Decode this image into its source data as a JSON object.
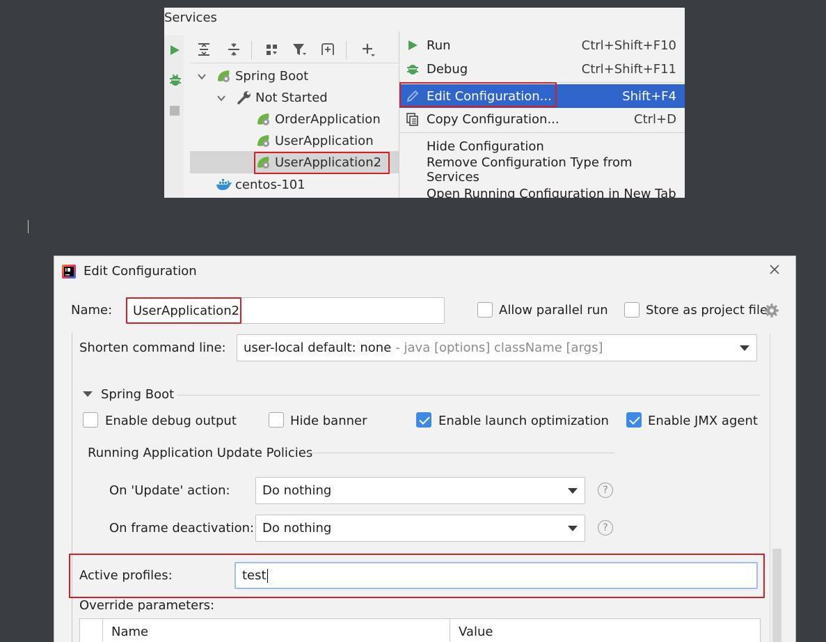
{
  "services": {
    "title": "Services",
    "tree": {
      "root": "Spring Boot",
      "group": "Not Started",
      "items": [
        "OrderApplication",
        "UserApplication",
        "UserApplication2"
      ],
      "other": "centos-101"
    },
    "menu": [
      {
        "label": "Run",
        "key": "Ctrl+Shift+F10"
      },
      {
        "label": "Debug",
        "key": "Ctrl+Shift+F11"
      },
      {
        "label": "Edit Configuration...",
        "key": "Shift+F4"
      },
      {
        "label": "Copy Configuration...",
        "key": "Ctrl+D"
      },
      {
        "label": "Hide Configuration",
        "key": ""
      },
      {
        "label": "Remove Configuration Type from Services",
        "key": ""
      },
      {
        "label": "Open Running Configuration in New Tab",
        "key": ""
      }
    ]
  },
  "dialog": {
    "title": "Edit Configuration",
    "name_label": "Name:",
    "name_value": "UserApplication2",
    "allow_parallel": "Allow parallel run",
    "store_project": "Store as project file",
    "shorten_label": "Shorten command line:",
    "shorten_value": "user-local default: none",
    "shorten_hint": "- java [options] className [args]",
    "spring_boot": "Spring Boot",
    "enable_debug": "Enable debug output",
    "hide_banner": "Hide banner",
    "launch_opt": "Enable launch optimization",
    "jmx_agent": "Enable JMX agent",
    "policies_title": "Running Application Update Policies",
    "update_label": "On 'Update' action:",
    "update_value": "Do nothing",
    "deact_label": "On frame deactivation:",
    "deact_value": "Do nothing",
    "profiles_label": "Active profiles:",
    "profiles_value": "test",
    "override_label": "Override parameters:",
    "col_name": "Name",
    "col_value": "Value",
    "question": "?"
  },
  "colors": {
    "highlight": "#2f65ca",
    "annotation": "#d32027",
    "check": "#3d8ae6"
  }
}
